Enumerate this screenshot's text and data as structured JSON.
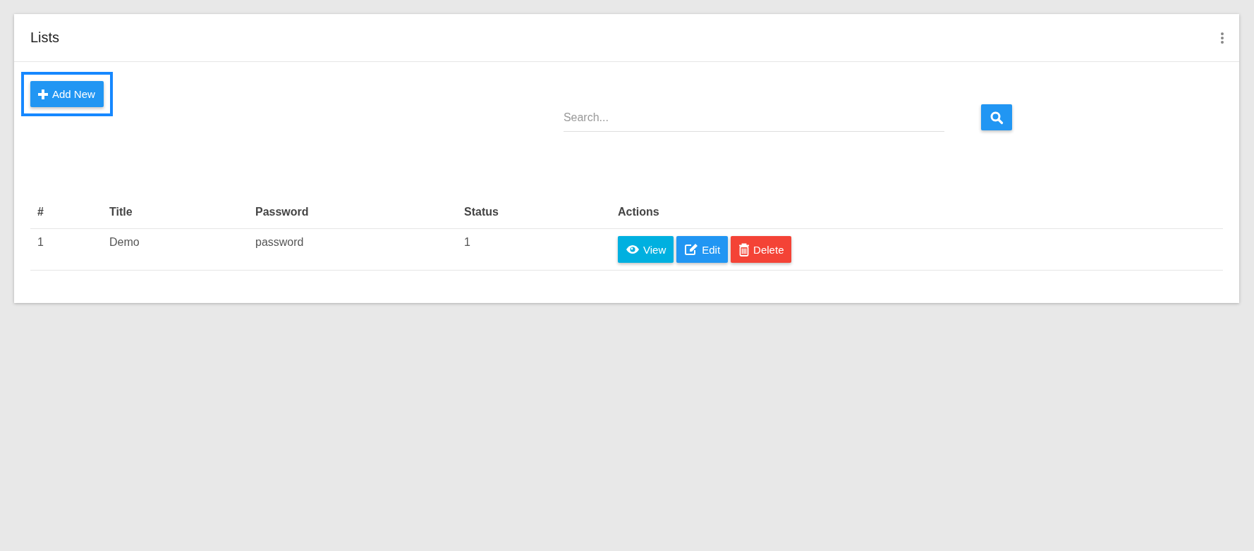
{
  "card": {
    "title": "Lists"
  },
  "add_button": {
    "label": "Add New",
    "highlighted": true
  },
  "search": {
    "placeholder": "Search..."
  },
  "table": {
    "columns": [
      "#",
      "Title",
      "Password",
      "Status",
      "Actions"
    ],
    "rows": [
      {
        "cells": [
          "1",
          "Demo",
          "password",
          "1"
        ],
        "actions": [
          {
            "kind": "view",
            "label": "View"
          },
          {
            "kind": "edit",
            "label": "Edit"
          },
          {
            "kind": "delete",
            "label": "Delete"
          }
        ]
      }
    ]
  }
}
